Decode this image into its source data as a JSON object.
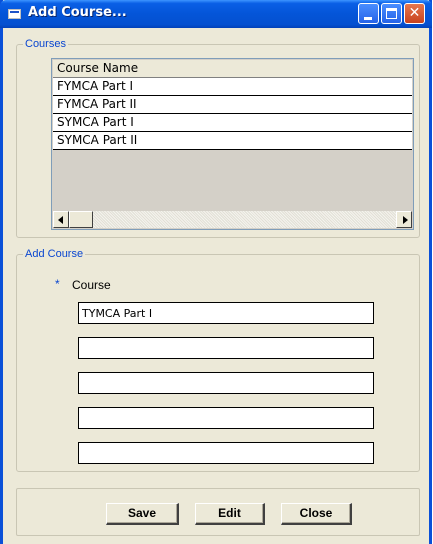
{
  "window": {
    "title": "Add Course...",
    "buttons": {
      "minimize": "minimize",
      "maximize": "maximize",
      "close": "✕"
    }
  },
  "courses_group": {
    "legend": "Courses",
    "column_header": "Course Name",
    "rows": [
      "FYMCA Part I",
      "FYMCA Part II",
      "SYMCA Part I",
      "SYMCA Part II"
    ]
  },
  "add_group": {
    "legend": "Add Course",
    "required_marker": "*",
    "course_label": "Course",
    "fields": [
      "TYMCA Part I",
      "",
      "",
      "",
      ""
    ]
  },
  "buttons": {
    "save": "Save",
    "edit": "Edit",
    "close": "Close"
  },
  "colors": {
    "titlebar": "#0455D8",
    "dialog_bg": "#ECE9D8",
    "legend": "#0A46D0",
    "close_button": "#C8421E"
  }
}
